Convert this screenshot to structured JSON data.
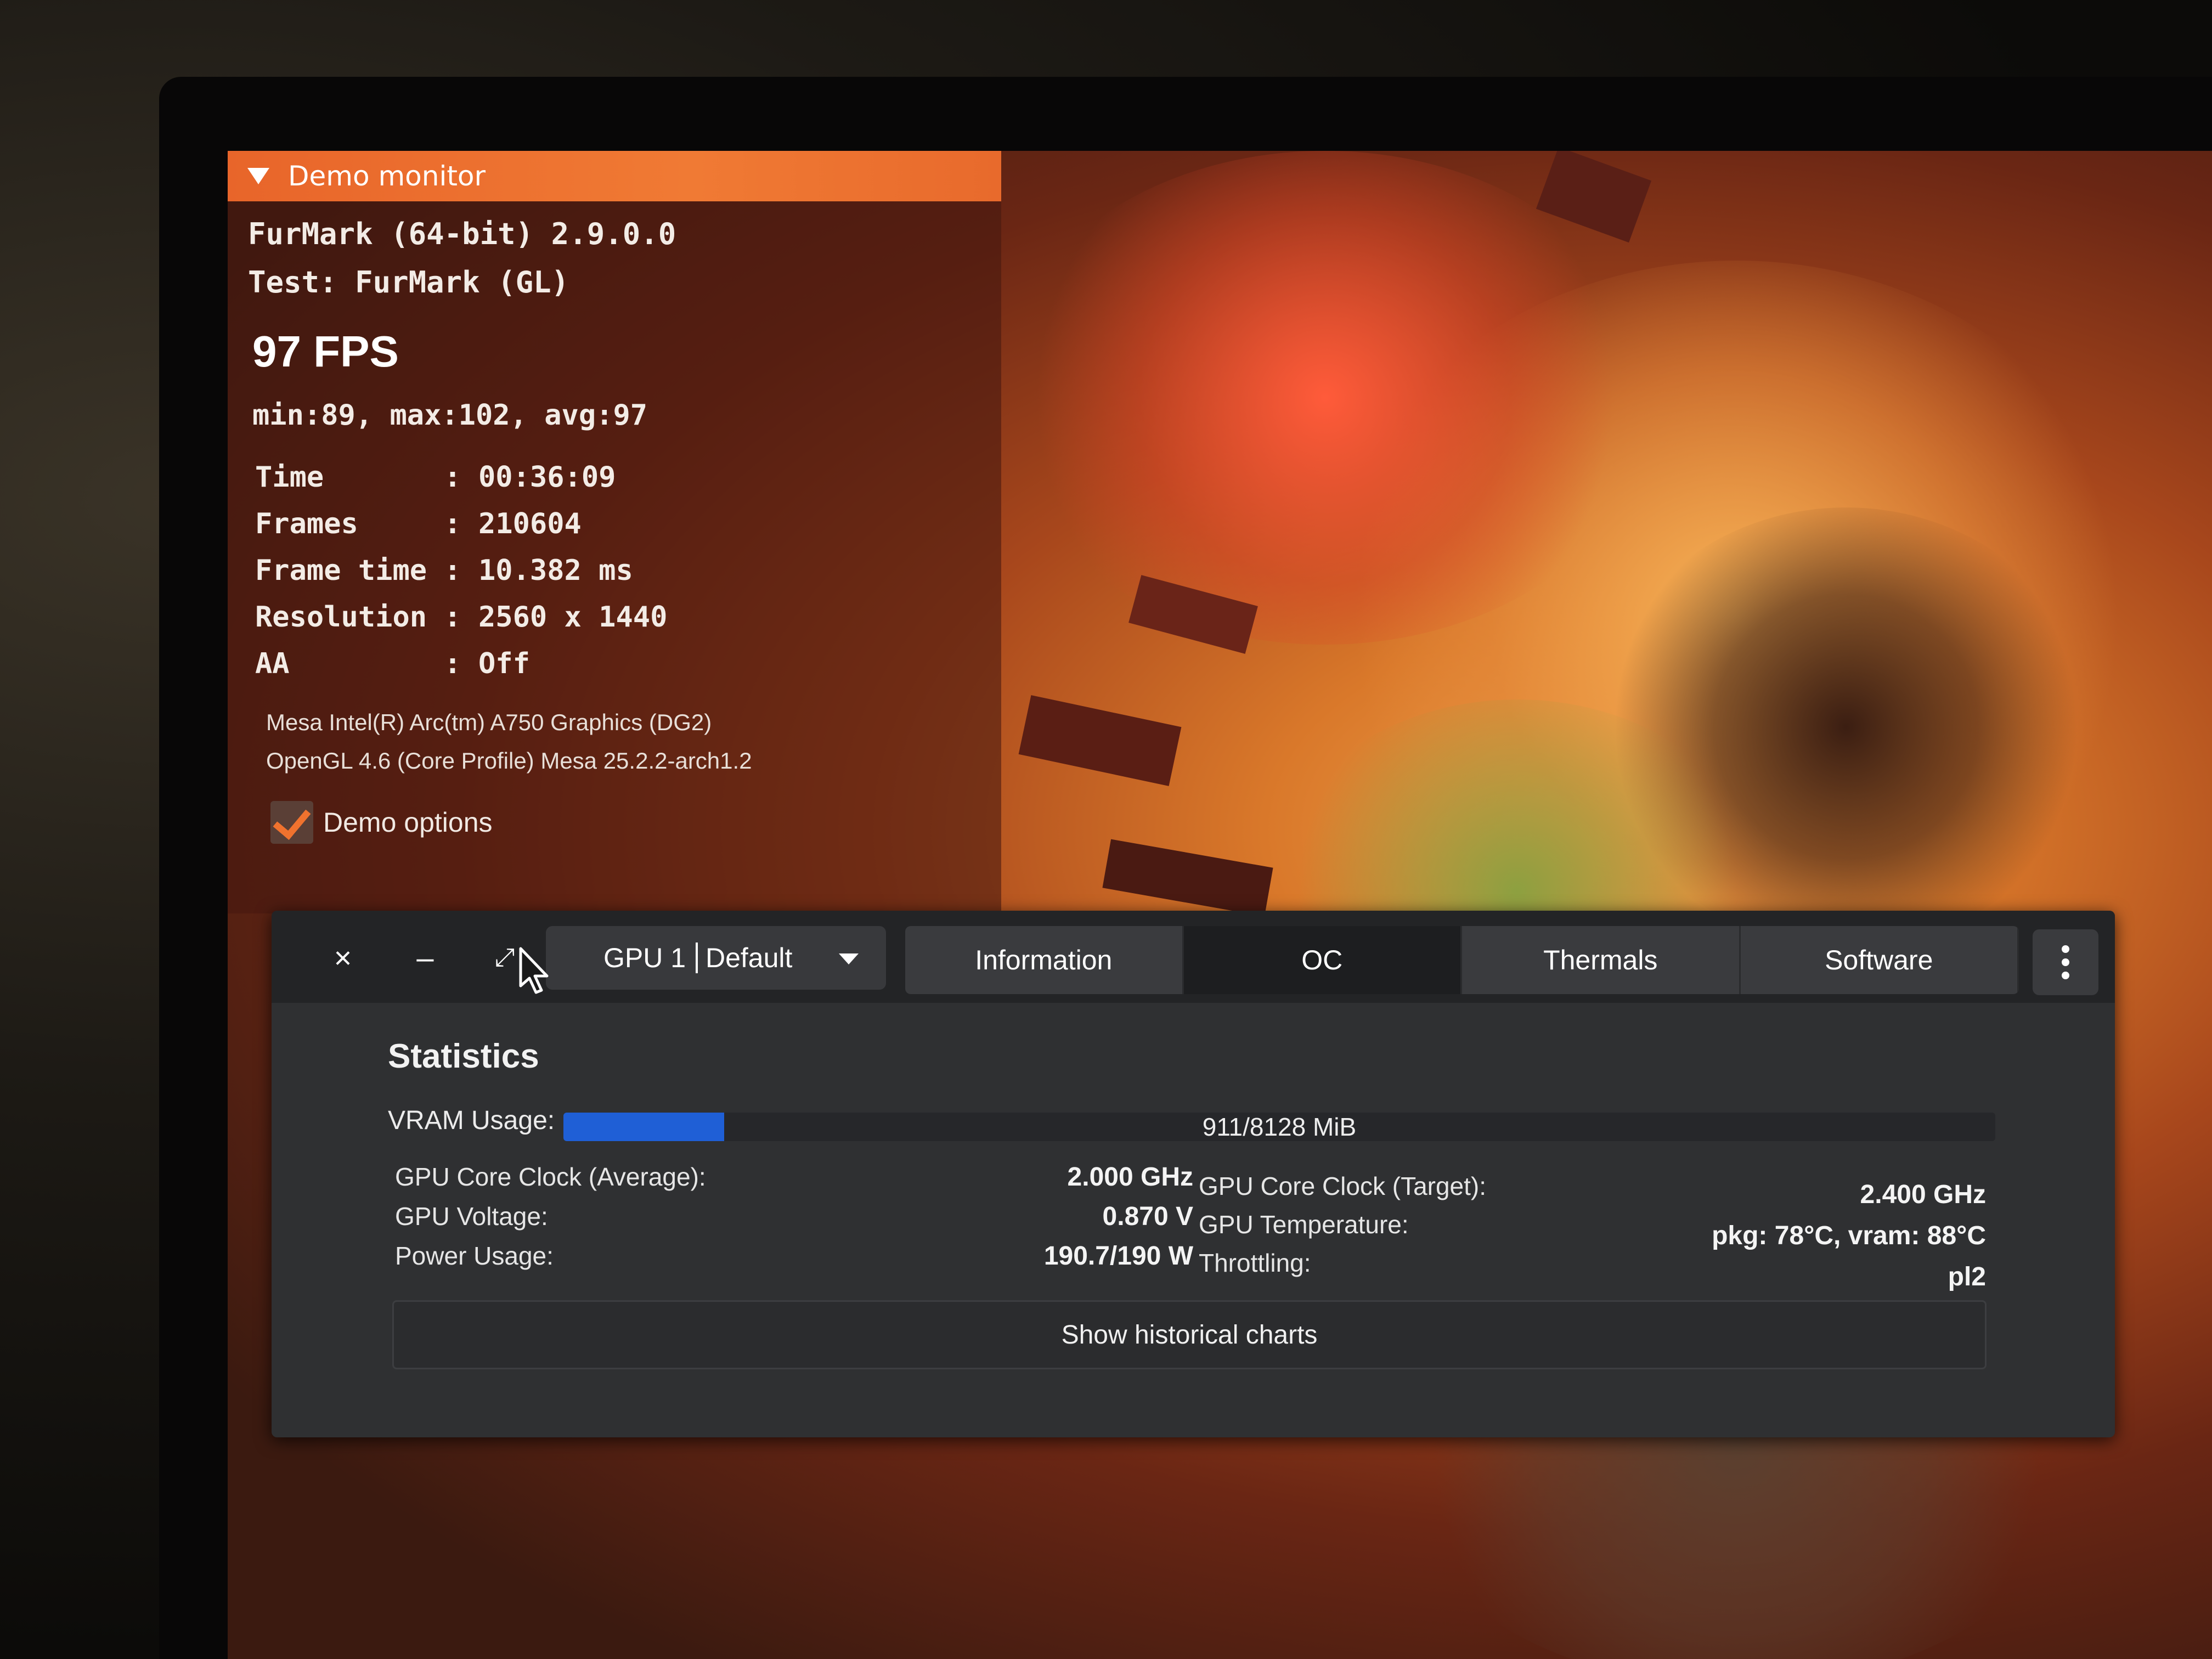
{
  "demo_monitor": {
    "title": "Demo monitor",
    "app_version": "FurMark (64-bit) 2.9.0.0",
    "test": "Test: FurMark (GL)",
    "fps": "97 FPS",
    "fps_stats": "min:89, max:102, avg:97",
    "stats": [
      {
        "label": "Time      ",
        "value": ": 00:36:09"
      },
      {
        "label": "Frames    ",
        "value": ": 210604"
      },
      {
        "label": "Frame time",
        "value": ": 10.382 ms"
      },
      {
        "label": "Resolution",
        "value": ": 2560 x 1440"
      },
      {
        "label": "AA        ",
        "value": ": Off"
      }
    ],
    "renderer": "Mesa Intel(R) Arc(tm) A750 Graphics (DG2)",
    "gl_version": "OpenGL 4.6 (Core Profile) Mesa 25.2.2-arch1.2",
    "demo_options_label": "Demo options",
    "demo_options_checked": true
  },
  "gpu_window": {
    "window_buttons": {
      "close": "×",
      "minimize": "–",
      "maximize": "⤢"
    },
    "gpu_select": {
      "gpu": "GPU 1",
      "profile": "Default"
    },
    "tabs": [
      {
        "label": "Information",
        "active": false
      },
      {
        "label": "OC",
        "active": true
      },
      {
        "label": "Thermals",
        "active": false
      },
      {
        "label": "Software",
        "active": false
      }
    ],
    "statistics": {
      "title": "Statistics",
      "vram_label": "VRAM Usage:",
      "vram_text": "911/8128 MiB",
      "vram_used": 911,
      "vram_total": 8128,
      "left": [
        {
          "label": "GPU Core Clock (Average):",
          "value": "2.000 GHz"
        },
        {
          "label": "GPU Voltage:",
          "value": "0.870 V"
        },
        {
          "label": "Power Usage:",
          "value": "190.7/190 W"
        }
      ],
      "right": [
        {
          "label": "GPU Core Clock (Target):",
          "value": "2.400 GHz"
        },
        {
          "label": "GPU Temperature:",
          "value": "pkg: 78°C, vram: 88°C"
        },
        {
          "label": "Throttling:",
          "value": "pl2"
        }
      ],
      "historical_button": "Show historical charts"
    },
    "colors": {
      "accent": "#1f5fd6",
      "furmark_orange": "#f07a34"
    }
  }
}
